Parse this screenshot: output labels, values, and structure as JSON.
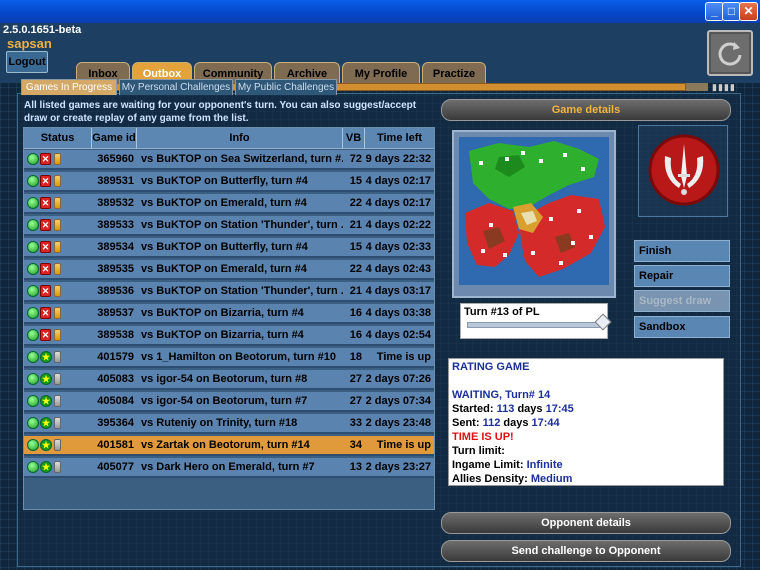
{
  "window": {
    "minimize": "_",
    "maximize": "□",
    "close": "✕"
  },
  "header": {
    "version": "2.5.0.1651-beta",
    "username": "sapsan",
    "logout": "Logout",
    "refresh_icon": "refresh-icon"
  },
  "tabs": [
    "Inbox",
    "Outbox",
    "Community",
    "Archive",
    "My Profile",
    "Practize"
  ],
  "active_tab": "Outbox",
  "subtabs": [
    "Games In Progress",
    "My Personal Challenges",
    "My Public Challenges"
  ],
  "info_text": "All listed games are waiting for your opponent's turn. You can also suggest/accept draw or create replay of any game from the list.",
  "table": {
    "headers": [
      "Status",
      "Game id",
      "Info",
      "VB",
      "Time left"
    ],
    "rows": [
      {
        "id": "365960",
        "info": "vs BuKTOP on Sea Switzerland, turn #...",
        "vb": "72",
        "time": "9 days 22:32",
        "icon": "red",
        "clock": "gold"
      },
      {
        "id": "389531",
        "info": "vs BuKTOP on Butterfly, turn #4",
        "vb": "15",
        "time": "4 days 02:17",
        "icon": "red",
        "clock": "gold"
      },
      {
        "id": "389532",
        "info": "vs BuKTOP on Emerald, turn #4",
        "vb": "22",
        "time": "4 days 02:17",
        "icon": "red",
        "clock": "gold"
      },
      {
        "id": "389533",
        "info": "vs BuKTOP on Station 'Thunder', turn ...",
        "vb": "21",
        "time": "4 days 02:22",
        "icon": "red",
        "clock": "gold"
      },
      {
        "id": "389534",
        "info": "vs BuKTOP on Butterfly, turn #4",
        "vb": "15",
        "time": "4 days 02:33",
        "icon": "red",
        "clock": "gold"
      },
      {
        "id": "389535",
        "info": "vs BuKTOP on Emerald, turn #4",
        "vb": "22",
        "time": "4 days 02:43",
        "icon": "red",
        "clock": "gold"
      },
      {
        "id": "389536",
        "info": "vs BuKTOP on Station 'Thunder', turn ...",
        "vb": "21",
        "time": "4 days 03:17",
        "icon": "red",
        "clock": "gold"
      },
      {
        "id": "389537",
        "info": "vs BuKTOP on Bizarria, turn #4",
        "vb": "16",
        "time": "4 days 03:38",
        "icon": "red",
        "clock": "gold"
      },
      {
        "id": "389538",
        "info": "vs BuKTOP on Bizarria, turn #4",
        "vb": "16",
        "time": "4 days 02:54",
        "icon": "red",
        "clock": "gold"
      },
      {
        "id": "401579",
        "info": "vs 1_Hamilton on Beotorum, turn #10",
        "vb": "18",
        "time": "Time is up",
        "icon": "star",
        "clock": "grey"
      },
      {
        "id": "405083",
        "info": "vs igor-54 on Beotorum, turn #8",
        "vb": "27",
        "time": "2 days 07:26",
        "icon": "star",
        "clock": "grey"
      },
      {
        "id": "405084",
        "info": "vs igor-54 on Beotorum, turn #7",
        "vb": "27",
        "time": "2 days 07:34",
        "icon": "star",
        "clock": "grey"
      },
      {
        "id": "395364",
        "info": "vs Ruteniy on Trinity, turn #18",
        "vb": "33",
        "time": "2 days 23:48",
        "icon": "star",
        "clock": "grey"
      },
      {
        "id": "401581",
        "info": "vs Zartak on Beotorum, turn #14",
        "vb": "34",
        "time": "Time is up",
        "icon": "star",
        "clock": "grey",
        "selected": true
      },
      {
        "id": "405077",
        "info": "vs Dark Hero on Emerald, turn #7",
        "vb": "13",
        "time": "2 days 23:27",
        "icon": "star",
        "clock": "grey"
      }
    ]
  },
  "details": {
    "title": "Game details",
    "turn_label": "Turn #13 of PL",
    "turn_progress": 1.0,
    "buttons": [
      "Finish",
      "Repair",
      "Suggest draw",
      "Sandbox"
    ],
    "info": {
      "rating": "RATING GAME",
      "waiting_label": "WAITING, Turn#",
      "waiting_value": "14",
      "started_label": "Started:",
      "started_days": "113",
      "started_mid": "days",
      "started_time": "17:45",
      "sent_label": "Sent:",
      "sent_days": "112",
      "sent_mid": "days",
      "sent_time": "17:44",
      "timeup": "TIME IS UP!",
      "turn_limit": "Turn limit:",
      "ingame_label": "Ingame Limit:",
      "ingame_value": "Infinite",
      "allies_label": "Allies Density:",
      "allies_value": "Medium"
    },
    "opponent_details": "Opponent details",
    "send_challenge": "Send challenge to Opponent"
  },
  "colors": {
    "accent": "#e3a23a",
    "title_gold": "#f3b540",
    "row_blue": "#5b83b0",
    "row_selected": "#e09a3c"
  }
}
